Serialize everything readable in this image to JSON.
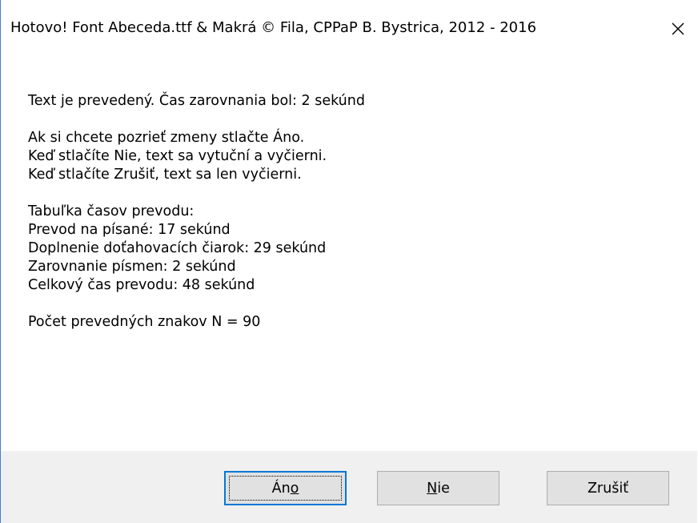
{
  "window": {
    "title": "Hotovo!   Font Abeceda.ttf & Makrá © Fila, CPPaP B. Bystrica, 2012 - 2016",
    "close_icon": "close-icon"
  },
  "message": {
    "result_line": "Text je prevedený. Čas zarovnania bol: 2 sekúnd",
    "instructions": [
      "Ak si chcete pozrieť zmeny stlačte Áno.",
      "Keď stlačíte Nie, text sa vytuční a vyčierni.",
      "Keď stlačíte Zrušiť, text sa len vyčierni."
    ],
    "table_title": "Tabuľka časov prevodu:",
    "table_rows": [
      "Prevod na písané: 17 sekúnd",
      "Doplnenie doťahovacích čiarok: 29 sekúnd",
      "Zarovnanie písmen: 2 sekúnd",
      "Celkový čas prevodu: 48 sekúnd"
    ],
    "char_count": "Počet prevedných znakov N = 90"
  },
  "buttons": {
    "yes": {
      "pre": "Án",
      "accel": "o",
      "post": ""
    },
    "no": {
      "pre": "",
      "accel": "N",
      "post": "ie"
    },
    "cancel": {
      "label": "Zrušiť"
    }
  }
}
